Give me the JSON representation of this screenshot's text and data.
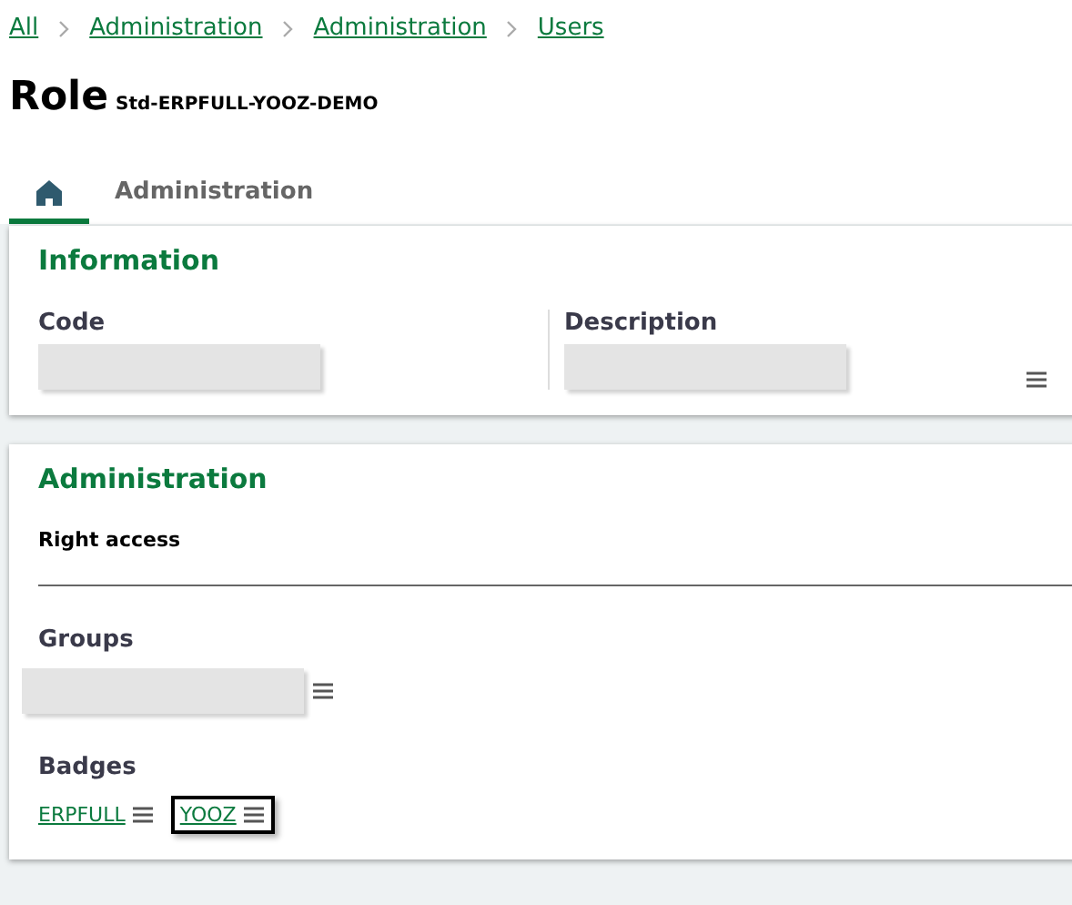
{
  "breadcrumb": [
    "All",
    "Administration",
    "Administration",
    "Users"
  ],
  "title": {
    "label": "Role",
    "code": "Std-ERPFULL-YOOZ-DEMO"
  },
  "tabs": [
    {
      "kind": "home",
      "selected": true
    },
    {
      "kind": "text",
      "label": "Administration",
      "selected": false
    }
  ],
  "information": {
    "heading": "Information",
    "fields": [
      {
        "label": "Code",
        "menu": false
      },
      {
        "label": "Description",
        "menu": true
      }
    ]
  },
  "administration": {
    "heading": "Administration",
    "subheading": "Right access",
    "groups_label": "Groups",
    "badges_label": "Badges",
    "badges": [
      {
        "label": "ERPFULL",
        "focused": false
      },
      {
        "label": "YOOZ",
        "focused": true
      }
    ]
  }
}
